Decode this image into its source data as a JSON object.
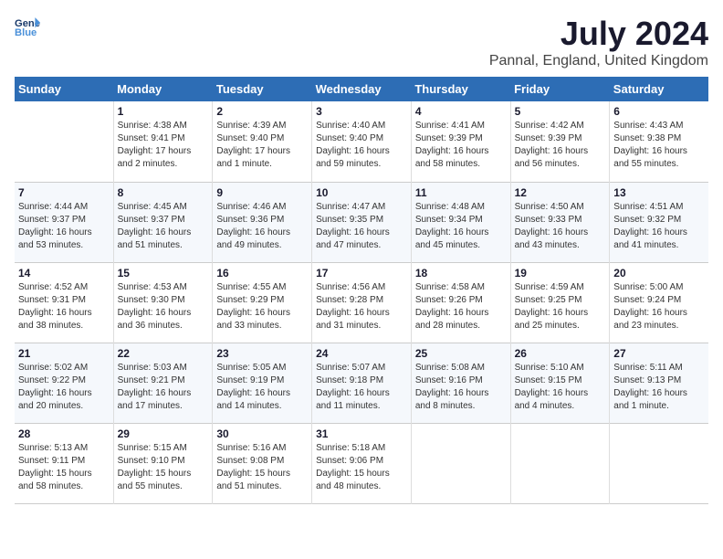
{
  "logo": {
    "line1": "General",
    "line2": "Blue"
  },
  "title": "July 2024",
  "subtitle": "Pannal, England, United Kingdom",
  "days_of_week": [
    "Sunday",
    "Monday",
    "Tuesday",
    "Wednesday",
    "Thursday",
    "Friday",
    "Saturday"
  ],
  "weeks": [
    [
      {
        "day": "",
        "info": ""
      },
      {
        "day": "1",
        "info": "Sunrise: 4:38 AM\nSunset: 9:41 PM\nDaylight: 17 hours\nand 2 minutes."
      },
      {
        "day": "2",
        "info": "Sunrise: 4:39 AM\nSunset: 9:40 PM\nDaylight: 17 hours\nand 1 minute."
      },
      {
        "day": "3",
        "info": "Sunrise: 4:40 AM\nSunset: 9:40 PM\nDaylight: 16 hours\nand 59 minutes."
      },
      {
        "day": "4",
        "info": "Sunrise: 4:41 AM\nSunset: 9:39 PM\nDaylight: 16 hours\nand 58 minutes."
      },
      {
        "day": "5",
        "info": "Sunrise: 4:42 AM\nSunset: 9:39 PM\nDaylight: 16 hours\nand 56 minutes."
      },
      {
        "day": "6",
        "info": "Sunrise: 4:43 AM\nSunset: 9:38 PM\nDaylight: 16 hours\nand 55 minutes."
      }
    ],
    [
      {
        "day": "7",
        "info": "Sunrise: 4:44 AM\nSunset: 9:37 PM\nDaylight: 16 hours\nand 53 minutes."
      },
      {
        "day": "8",
        "info": "Sunrise: 4:45 AM\nSunset: 9:37 PM\nDaylight: 16 hours\nand 51 minutes."
      },
      {
        "day": "9",
        "info": "Sunrise: 4:46 AM\nSunset: 9:36 PM\nDaylight: 16 hours\nand 49 minutes."
      },
      {
        "day": "10",
        "info": "Sunrise: 4:47 AM\nSunset: 9:35 PM\nDaylight: 16 hours\nand 47 minutes."
      },
      {
        "day": "11",
        "info": "Sunrise: 4:48 AM\nSunset: 9:34 PM\nDaylight: 16 hours\nand 45 minutes."
      },
      {
        "day": "12",
        "info": "Sunrise: 4:50 AM\nSunset: 9:33 PM\nDaylight: 16 hours\nand 43 minutes."
      },
      {
        "day": "13",
        "info": "Sunrise: 4:51 AM\nSunset: 9:32 PM\nDaylight: 16 hours\nand 41 minutes."
      }
    ],
    [
      {
        "day": "14",
        "info": "Sunrise: 4:52 AM\nSunset: 9:31 PM\nDaylight: 16 hours\nand 38 minutes."
      },
      {
        "day": "15",
        "info": "Sunrise: 4:53 AM\nSunset: 9:30 PM\nDaylight: 16 hours\nand 36 minutes."
      },
      {
        "day": "16",
        "info": "Sunrise: 4:55 AM\nSunset: 9:29 PM\nDaylight: 16 hours\nand 33 minutes."
      },
      {
        "day": "17",
        "info": "Sunrise: 4:56 AM\nSunset: 9:28 PM\nDaylight: 16 hours\nand 31 minutes."
      },
      {
        "day": "18",
        "info": "Sunrise: 4:58 AM\nSunset: 9:26 PM\nDaylight: 16 hours\nand 28 minutes."
      },
      {
        "day": "19",
        "info": "Sunrise: 4:59 AM\nSunset: 9:25 PM\nDaylight: 16 hours\nand 25 minutes."
      },
      {
        "day": "20",
        "info": "Sunrise: 5:00 AM\nSunset: 9:24 PM\nDaylight: 16 hours\nand 23 minutes."
      }
    ],
    [
      {
        "day": "21",
        "info": "Sunrise: 5:02 AM\nSunset: 9:22 PM\nDaylight: 16 hours\nand 20 minutes."
      },
      {
        "day": "22",
        "info": "Sunrise: 5:03 AM\nSunset: 9:21 PM\nDaylight: 16 hours\nand 17 minutes."
      },
      {
        "day": "23",
        "info": "Sunrise: 5:05 AM\nSunset: 9:19 PM\nDaylight: 16 hours\nand 14 minutes."
      },
      {
        "day": "24",
        "info": "Sunrise: 5:07 AM\nSunset: 9:18 PM\nDaylight: 16 hours\nand 11 minutes."
      },
      {
        "day": "25",
        "info": "Sunrise: 5:08 AM\nSunset: 9:16 PM\nDaylight: 16 hours\nand 8 minutes."
      },
      {
        "day": "26",
        "info": "Sunrise: 5:10 AM\nSunset: 9:15 PM\nDaylight: 16 hours\nand 4 minutes."
      },
      {
        "day": "27",
        "info": "Sunrise: 5:11 AM\nSunset: 9:13 PM\nDaylight: 16 hours\nand 1 minute."
      }
    ],
    [
      {
        "day": "28",
        "info": "Sunrise: 5:13 AM\nSunset: 9:11 PM\nDaylight: 15 hours\nand 58 minutes."
      },
      {
        "day": "29",
        "info": "Sunrise: 5:15 AM\nSunset: 9:10 PM\nDaylight: 15 hours\nand 55 minutes."
      },
      {
        "day": "30",
        "info": "Sunrise: 5:16 AM\nSunset: 9:08 PM\nDaylight: 15 hours\nand 51 minutes."
      },
      {
        "day": "31",
        "info": "Sunrise: 5:18 AM\nSunset: 9:06 PM\nDaylight: 15 hours\nand 48 minutes."
      },
      {
        "day": "",
        "info": ""
      },
      {
        "day": "",
        "info": ""
      },
      {
        "day": "",
        "info": ""
      }
    ]
  ]
}
